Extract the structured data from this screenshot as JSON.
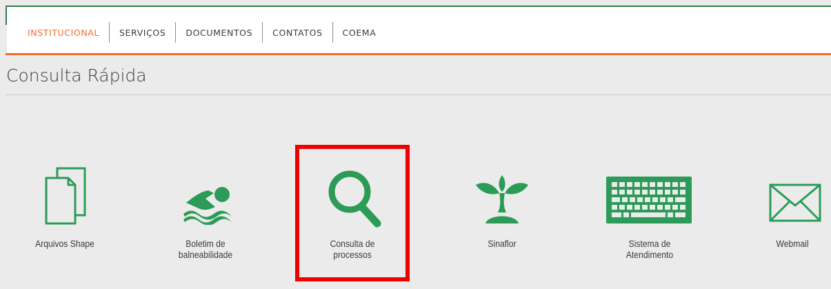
{
  "nav": {
    "items": [
      {
        "label": "INSTITUCIONAL",
        "active": true
      },
      {
        "label": "SERVIÇOS",
        "active": false
      },
      {
        "label": "DOCUMENTOS",
        "active": false
      },
      {
        "label": "CONTATOS",
        "active": false
      },
      {
        "label": "COEMA",
        "active": false
      }
    ]
  },
  "page_title": "Consulta Rápida",
  "tiles": [
    {
      "label": "Arquivos Shape",
      "icon": "document-copy-icon"
    },
    {
      "label": "Boletim de\nbalneabilidade",
      "icon": "swimmer-icon"
    },
    {
      "label": "Consulta de\nprocessos",
      "icon": "magnifier-icon"
    },
    {
      "label": "Sinaflor",
      "icon": "sprout-icon"
    },
    {
      "label": "Sistema de\nAtendimento",
      "icon": "keyboard-icon"
    },
    {
      "label": "Webmail",
      "icon": "envelope-icon"
    }
  ],
  "colors": {
    "accent_orange": "#f26b2a",
    "brand_green": "#2b9b57",
    "highlight_red": "#ee0000",
    "background": "#ebebeb"
  }
}
